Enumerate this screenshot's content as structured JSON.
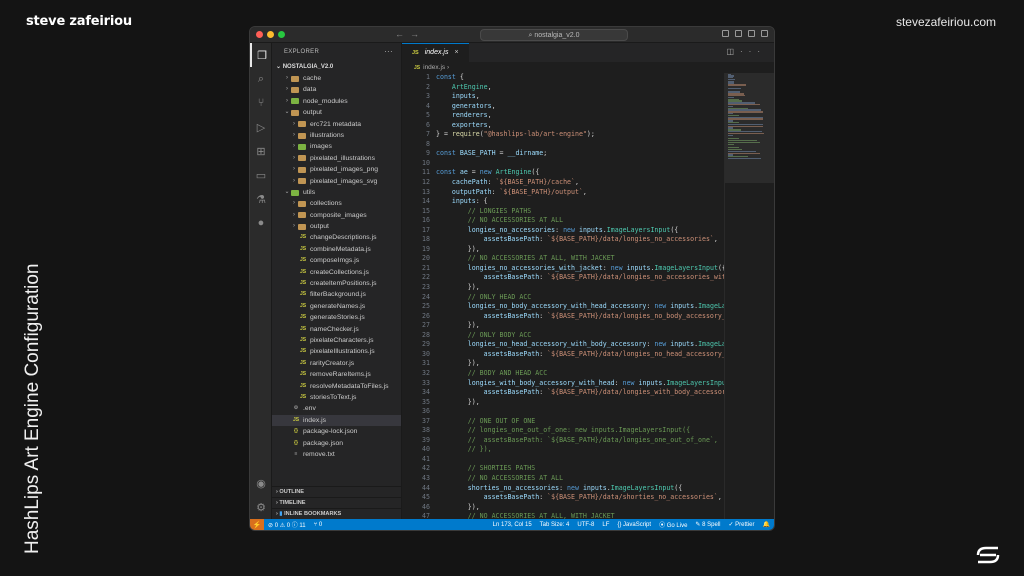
{
  "page": {
    "brand": "steve zafeiriou",
    "site": "stevezafeiriou.com",
    "vertical_title": "HashLips Art Engine Configuration"
  },
  "window": {
    "command_center": "nostalgia_v2.0"
  },
  "sidebar": {
    "header": "EXPLORER",
    "more": "···",
    "project": "NOSTALGIA_V2.0",
    "items": [
      {
        "label": "cache",
        "type": "folder",
        "depth": 1,
        "chev": "›",
        "color": "#c09553"
      },
      {
        "label": "data",
        "type": "folder",
        "depth": 1,
        "chev": "›",
        "color": "#c09553"
      },
      {
        "label": "node_modules",
        "type": "folder",
        "depth": 1,
        "chev": "›",
        "color": "#7cb342"
      },
      {
        "label": "output",
        "type": "folder",
        "depth": 1,
        "chev": "⌄",
        "color": "#c09553"
      },
      {
        "label": "erc721 metadata",
        "type": "folder",
        "depth": 2,
        "chev": "›",
        "color": "#c09553"
      },
      {
        "label": "illustrations",
        "type": "folder",
        "depth": 2,
        "chev": "›",
        "color": "#c09553"
      },
      {
        "label": "images",
        "type": "folder",
        "depth": 2,
        "chev": "›",
        "color": "#7cb342"
      },
      {
        "label": "pixelated_illustrations",
        "type": "folder",
        "depth": 2,
        "chev": "›",
        "color": "#c09553"
      },
      {
        "label": "pixelated_images_png",
        "type": "folder",
        "depth": 2,
        "chev": "›",
        "color": "#c09553"
      },
      {
        "label": "pixelated_images_svg",
        "type": "folder",
        "depth": 2,
        "chev": "›",
        "color": "#c09553"
      },
      {
        "label": "utils",
        "type": "folder",
        "depth": 1,
        "chev": "⌄",
        "color": "#7cb342"
      },
      {
        "label": "collections",
        "type": "folder",
        "depth": 2,
        "chev": "›",
        "color": "#c09553"
      },
      {
        "label": "composite_images",
        "type": "folder",
        "depth": 2,
        "chev": "›",
        "color": "#c09553"
      },
      {
        "label": "output",
        "type": "folder",
        "depth": 2,
        "chev": "›",
        "color": "#c09553"
      },
      {
        "label": "changeDescriptions.js",
        "type": "js",
        "depth": 2
      },
      {
        "label": "combineMetadata.js",
        "type": "js",
        "depth": 2
      },
      {
        "label": "composeImgs.js",
        "type": "js",
        "depth": 2
      },
      {
        "label": "createCollections.js",
        "type": "js",
        "depth": 2
      },
      {
        "label": "createItemPositions.js",
        "type": "js",
        "depth": 2
      },
      {
        "label": "filterBackground.js",
        "type": "js",
        "depth": 2
      },
      {
        "label": "generateNames.js",
        "type": "js",
        "depth": 2
      },
      {
        "label": "generateStories.js",
        "type": "js",
        "depth": 2
      },
      {
        "label": "nameChecker.js",
        "type": "js",
        "depth": 2
      },
      {
        "label": "pixelateCharacters.js",
        "type": "js",
        "depth": 2
      },
      {
        "label": "pixelateIllustrations.js",
        "type": "js",
        "depth": 2
      },
      {
        "label": "rarityCreator.js",
        "type": "js",
        "depth": 2
      },
      {
        "label": "removeRareItems.js",
        "type": "js",
        "depth": 2
      },
      {
        "label": "resolveMetadataToFiles.js",
        "type": "js",
        "depth": 2
      },
      {
        "label": "storiesToText.js",
        "type": "js",
        "depth": 2
      },
      {
        "label": ".env",
        "type": "env",
        "depth": 1
      },
      {
        "label": "index.js",
        "type": "js",
        "depth": 1,
        "selected": true
      },
      {
        "label": "package-lock.json",
        "type": "json",
        "depth": 1
      },
      {
        "label": "package.json",
        "type": "json",
        "depth": 1
      },
      {
        "label": "remove.txt",
        "type": "txt",
        "depth": 1
      }
    ],
    "sections": [
      "OUTLINE",
      "TIMELINE",
      "INLINE BOOKMARKS"
    ]
  },
  "editor": {
    "tab_label": "index.js",
    "breadcrumb": "index.js",
    "icon_js": "JS",
    "start_line": 1,
    "lines": [
      [
        [
          "kw",
          "const"
        ],
        [
          "p",
          " {"
        ]
      ],
      [
        [
          "p",
          "    "
        ],
        [
          "cls",
          "ArtEngine"
        ],
        [
          "p",
          ","
        ]
      ],
      [
        [
          "p",
          "    "
        ],
        [
          "id",
          "inputs"
        ],
        [
          "p",
          ","
        ]
      ],
      [
        [
          "p",
          "    "
        ],
        [
          "id",
          "generators"
        ],
        [
          "p",
          ","
        ]
      ],
      [
        [
          "p",
          "    "
        ],
        [
          "id",
          "renderers"
        ],
        [
          "p",
          ","
        ]
      ],
      [
        [
          "p",
          "    "
        ],
        [
          "id",
          "exporters"
        ],
        [
          "p",
          ","
        ]
      ],
      [
        [
          "p",
          "} = "
        ],
        [
          "fn",
          "require"
        ],
        [
          "p",
          "("
        ],
        [
          "str",
          "\"@hashlips-lab/art-engine\""
        ],
        [
          "p",
          ");"
        ]
      ],
      [],
      [
        [
          "kw",
          "const"
        ],
        [
          "p",
          " "
        ],
        [
          "id",
          "BASE_PATH"
        ],
        [
          "p",
          " = "
        ],
        [
          "id",
          "__dirname"
        ],
        [
          "p",
          ";"
        ]
      ],
      [],
      [
        [
          "kw",
          "const"
        ],
        [
          "p",
          " "
        ],
        [
          "id",
          "ae"
        ],
        [
          "p",
          " = "
        ],
        [
          "kw",
          "new"
        ],
        [
          "p",
          " "
        ],
        [
          "cls",
          "ArtEngine"
        ],
        [
          "p",
          "({"
        ]
      ],
      [
        [
          "p",
          "    "
        ],
        [
          "id",
          "cachePath"
        ],
        [
          "p",
          ": "
        ],
        [
          "str",
          "`${BASE_PATH}/cache`"
        ],
        [
          "p",
          ","
        ]
      ],
      [
        [
          "p",
          "    "
        ],
        [
          "id",
          "outputPath"
        ],
        [
          "p",
          ": "
        ],
        [
          "str",
          "`${BASE_PATH}/output`"
        ],
        [
          "p",
          ","
        ]
      ],
      [
        [
          "p",
          "    "
        ],
        [
          "id",
          "inputs"
        ],
        [
          "p",
          ": {"
        ]
      ],
      [
        [
          "p",
          "        "
        ],
        [
          "cm",
          "// LONGIES PATHS"
        ]
      ],
      [
        [
          "p",
          "        "
        ],
        [
          "cm",
          "// NO ACCESSORIES AT ALL"
        ]
      ],
      [
        [
          "p",
          "        "
        ],
        [
          "id",
          "longies_no_accessories"
        ],
        [
          "p",
          ": "
        ],
        [
          "kw",
          "new"
        ],
        [
          "p",
          " "
        ],
        [
          "id",
          "inputs"
        ],
        [
          "p",
          "."
        ],
        [
          "cls",
          "ImageLayersInput"
        ],
        [
          "p",
          "({"
        ]
      ],
      [
        [
          "p",
          "            "
        ],
        [
          "id",
          "assetsBasePath"
        ],
        [
          "p",
          ": "
        ],
        [
          "str",
          "`${BASE_PATH}/data/longies_no_accessories`"
        ],
        [
          "p",
          ","
        ]
      ],
      [
        [
          "p",
          "        }),"
        ]
      ],
      [
        [
          "p",
          "        "
        ],
        [
          "cm",
          "// NO ACCESSORIES AT ALL, WITH JACKET"
        ]
      ],
      [
        [
          "p",
          "        "
        ],
        [
          "id",
          "longies_no_accessories_with_jacket"
        ],
        [
          "p",
          ": "
        ],
        [
          "kw",
          "new"
        ],
        [
          "p",
          " "
        ],
        [
          "id",
          "inputs"
        ],
        [
          "p",
          "."
        ],
        [
          "cls",
          "ImageLayersInput"
        ],
        [
          "p",
          "({"
        ]
      ],
      [
        [
          "p",
          "            "
        ],
        [
          "id",
          "assetsBasePath"
        ],
        [
          "p",
          ": "
        ],
        [
          "str",
          "`${BASE_PATH}/data/longies_no_accessories_with_jac"
        ]
      ],
      [
        [
          "p",
          "        }),"
        ]
      ],
      [
        [
          "p",
          "        "
        ],
        [
          "cm",
          "// ONLY HEAD ACC"
        ]
      ],
      [
        [
          "p",
          "        "
        ],
        [
          "id",
          "longies_no_body_accessory_with_head_accessory"
        ],
        [
          "p",
          ": "
        ],
        [
          "kw",
          "new"
        ],
        [
          "p",
          " "
        ],
        [
          "id",
          "inputs"
        ],
        [
          "p",
          "."
        ],
        [
          "cls",
          "ImageLayersI"
        ]
      ],
      [
        [
          "p",
          "            "
        ],
        [
          "id",
          "assetsBasePath"
        ],
        [
          "p",
          ": "
        ],
        [
          "str",
          "`${BASE_PATH}/data/longies_no_body_accessory_with_"
        ]
      ],
      [
        [
          "p",
          "        }),"
        ]
      ],
      [
        [
          "p",
          "        "
        ],
        [
          "cm",
          "// ONLY BODY ACC"
        ]
      ],
      [
        [
          "p",
          "        "
        ],
        [
          "id",
          "longies_no_head_accessory_with_body_accessory"
        ],
        [
          "p",
          ": "
        ],
        [
          "kw",
          "new"
        ],
        [
          "p",
          " "
        ],
        [
          "id",
          "inputs"
        ],
        [
          "p",
          "."
        ],
        [
          "cls",
          "ImageLayersI"
        ]
      ],
      [
        [
          "p",
          "            "
        ],
        [
          "id",
          "assetsBasePath"
        ],
        [
          "p",
          ": "
        ],
        [
          "str",
          "`${BASE_PATH}/data/longies_no_head_accessory_with_"
        ]
      ],
      [
        [
          "p",
          "        }),"
        ]
      ],
      [
        [
          "p",
          "        "
        ],
        [
          "cm",
          "// BODY AND HEAD ACC"
        ]
      ],
      [
        [
          "p",
          "        "
        ],
        [
          "id",
          "longies_with_body_accessory_with_head"
        ],
        [
          "p",
          ": "
        ],
        [
          "kw",
          "new"
        ],
        [
          "p",
          " "
        ],
        [
          "id",
          "inputs"
        ],
        [
          "p",
          "."
        ],
        [
          "cls",
          "ImageLayersInput"
        ],
        [
          "p",
          "({"
        ]
      ],
      [
        [
          "p",
          "            "
        ],
        [
          "id",
          "assetsBasePath"
        ],
        [
          "p",
          ": "
        ],
        [
          "str",
          "`${BASE_PATH}/data/longies_with_body_accessory_with_"
        ]
      ],
      [
        [
          "p",
          "        }),"
        ]
      ],
      [],
      [
        [
          "p",
          "        "
        ],
        [
          "cm",
          "// ONE OUT OF ONE"
        ]
      ],
      [
        [
          "p",
          "        "
        ],
        [
          "cm",
          "// longies_one_out_of_one: new inputs.ImageLayersInput({"
        ]
      ],
      [
        [
          "p",
          "        "
        ],
        [
          "cm",
          "//  assetsBasePath: `${BASE_PATH}/data/longies_one_out_of_one`,"
        ]
      ],
      [
        [
          "p",
          "        "
        ],
        [
          "cm",
          "// }),"
        ]
      ],
      [],
      [
        [
          "p",
          "        "
        ],
        [
          "cm",
          "// SHORTIES PATHS"
        ]
      ],
      [
        [
          "p",
          "        "
        ],
        [
          "cm",
          "// NO ACCESSORIES AT ALL"
        ]
      ],
      [
        [
          "p",
          "        "
        ],
        [
          "id",
          "shorties_no_accessories"
        ],
        [
          "p",
          ": "
        ],
        [
          "kw",
          "new"
        ],
        [
          "p",
          " "
        ],
        [
          "id",
          "inputs"
        ],
        [
          "p",
          "."
        ],
        [
          "cls",
          "ImageLayersInput"
        ],
        [
          "p",
          "({"
        ]
      ],
      [
        [
          "p",
          "            "
        ],
        [
          "id",
          "assetsBasePath"
        ],
        [
          "p",
          ": "
        ],
        [
          "str",
          "`${BASE_PATH}/data/shorties_no_accessories`"
        ],
        [
          "p",
          ","
        ]
      ],
      [
        [
          "p",
          "        }),"
        ]
      ],
      [
        [
          "p",
          "        "
        ],
        [
          "cm",
          "// NO ACCESSORIES AT ALL, WITH JACKET"
        ]
      ],
      [
        [
          "p",
          "        "
        ],
        [
          "id",
          "shorties_no_accessories_with_jacket"
        ],
        [
          "p",
          ": "
        ],
        [
          "kw",
          "new"
        ],
        [
          "p",
          " "
        ],
        [
          "id",
          "inputs"
        ],
        [
          "p",
          "."
        ],
        [
          "cls",
          "ImageLayersInput"
        ],
        [
          "p",
          "({"
        ]
      ]
    ]
  },
  "status": {
    "remote": "⚡",
    "problems": "⊘ 0 ⚠ 0 ⓘ 11",
    "ports": "⑂ 0",
    "position": "Ln 173, Col 15",
    "tab_size": "Tab Size: 4",
    "encoding": "UTF-8",
    "eol": "LF",
    "language": "{} JavaScript",
    "go_live": "⦿ Go Live",
    "spell": "✎ 8 Spell",
    "prettier": "✓ Prettier"
  },
  "colors": {
    "accent": "#007acc",
    "remote": "#d86f1d",
    "sidebar": "#252526",
    "editor": "#1e1e1e"
  }
}
